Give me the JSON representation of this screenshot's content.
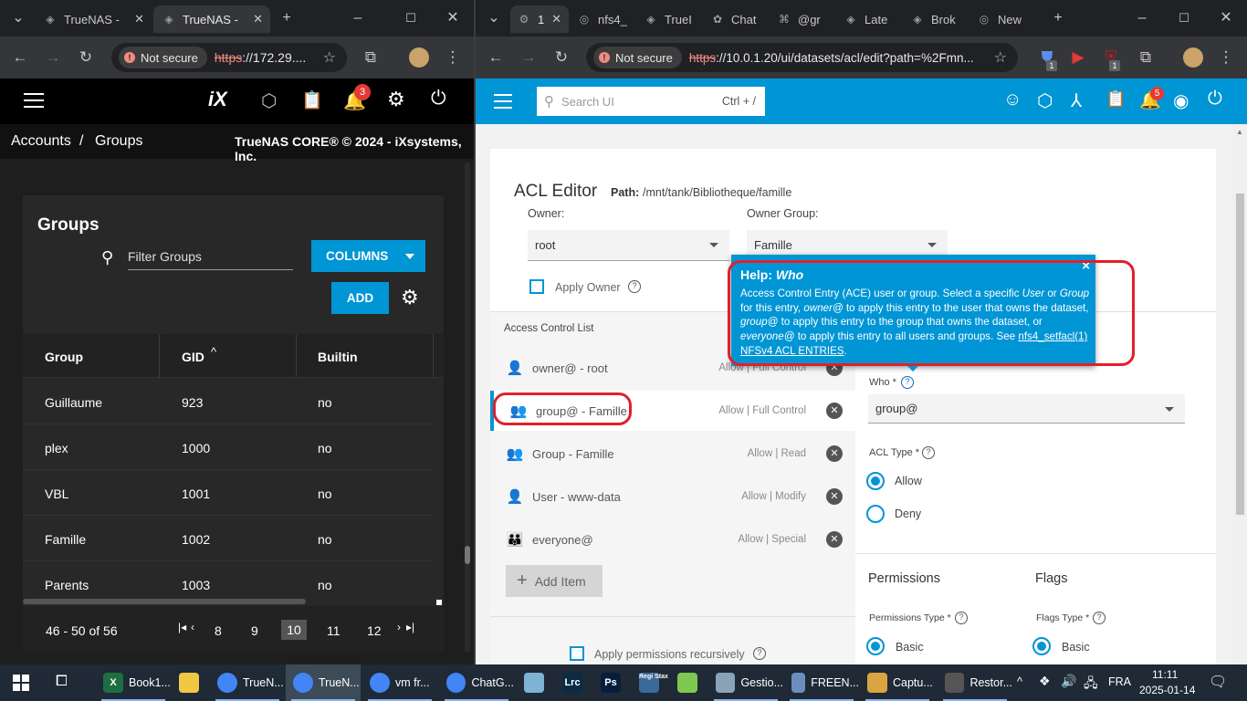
{
  "left_browser": {
    "tabs": [
      {
        "label": "TrueNAS -",
        "active": false
      },
      {
        "label": "TrueNAS -",
        "active": true
      }
    ],
    "not_secure": "Not secure",
    "url_scheme": "https",
    "url_rest": "://172.29....",
    "header": {
      "notif_count": "3"
    },
    "breadcrumb": {
      "accounts": "Accounts",
      "sep": "/",
      "groups": "Groups",
      "copyright": "TrueNAS CORE® © 2024 - iXsystems, Inc."
    },
    "groups": {
      "title": "Groups",
      "filter_placeholder": "Filter Groups",
      "columns_label": "COLUMNS",
      "add_label": "ADD",
      "headers": [
        "Group",
        "GID",
        "Builtin"
      ],
      "sort_indicator": "^",
      "rows": [
        {
          "group": "Guillaume",
          "gid": "923",
          "builtin": "no"
        },
        {
          "group": "plex",
          "gid": "1000",
          "builtin": "no"
        },
        {
          "group": "VBL",
          "gid": "1001",
          "builtin": "no"
        },
        {
          "group": "Famille",
          "gid": "1002",
          "builtin": "no"
        },
        {
          "group": "Parents",
          "gid": "1003",
          "builtin": "no"
        }
      ],
      "range": "46 - 50 of 56",
      "pages": [
        "8",
        "9",
        "10",
        "11",
        "12"
      ],
      "current_page": "10"
    }
  },
  "right_browser": {
    "tabs": [
      "1",
      "nfs4_",
      "TrueI",
      "Chat",
      "@gr",
      "Late",
      "Brok",
      "New"
    ],
    "not_secure": "Not secure",
    "url_scheme": "https",
    "url_rest": "://10.0.1.20/ui/datasets/acl/edit?path=%2Fmn...",
    "ext_badges": [
      "1",
      "1"
    ],
    "search_placeholder": "Search UI",
    "search_shortcut": "Ctrl + /",
    "notif_count": "5",
    "acl": {
      "title": "ACL Editor",
      "path_label": "Path:",
      "path_value": "/mnt/tank/Bibliotheque/famille",
      "owner_label": "Owner:",
      "owner_value": "root",
      "owner_group_label": "Owner Group:",
      "owner_group_value": "Famille",
      "apply_owner": "Apply Owner",
      "list_title": "Access Control List",
      "entries": [
        {
          "name": "owner@ - root",
          "perm": "Allow | Full Control",
          "icon": "person-icon"
        },
        {
          "name": "group@ - Famille",
          "perm": "Allow | Full Control",
          "icon": "group-icon"
        },
        {
          "name": "Group - Famille",
          "perm": "Allow | Read",
          "icon": "group-icon"
        },
        {
          "name": "User - www-data",
          "perm": "Allow | Modify",
          "icon": "person-icon"
        },
        {
          "name": "everyone@",
          "perm": "Allow | Special",
          "icon": "groups-icon"
        }
      ],
      "add_item": "Add Item",
      "apply_recursive": "Apply permissions recursively",
      "who_label": "Who *",
      "who_value": "group@",
      "acl_type_label": "ACL Type *",
      "allow": "Allow",
      "deny": "Deny",
      "permissions_title": "Permissions",
      "flags_title": "Flags",
      "permissions_type_label": "Permissions Type *",
      "flags_type_label": "Flags Type *",
      "basic": "Basic",
      "help": {
        "title_prefix": "Help: ",
        "title_word": "Who",
        "close": "×",
        "t1": "Access Control Entry (ACE) user or group. Select a specific ",
        "i1": "User",
        "t2": " or ",
        "i2": "Group",
        "t3": " for this entry, ",
        "i3": "owner@",
        "t4": " to apply this entry to the user that owns the dataset, ",
        "i4": "group@",
        "t5": " to apply this entry to the group that owns the dataset, or ",
        "i5": "everyone@",
        "t6": " to apply this entry to all users and groups. See ",
        "link": "nfs4_setfacl(1) NFSv4 ACL ENTRIES",
        "t7": "."
      }
    }
  },
  "taskbar": {
    "items": [
      {
        "label": "Book1...",
        "icon_text": "X",
        "color": "#1d6f42"
      },
      {
        "label": "",
        "icon_text": "",
        "color": "#f2c744"
      },
      {
        "label": "TrueN...",
        "icon_text": "",
        "color": "#4285f4"
      },
      {
        "label": "TrueN...",
        "icon_text": "",
        "color": "#4285f4"
      },
      {
        "label": "vm fr...",
        "icon_text": "",
        "color": "#4285f4"
      },
      {
        "label": "ChatG...",
        "icon_text": "",
        "color": "#4285f4"
      },
      {
        "label": "",
        "icon_text": "",
        "color": "#7fb3d5"
      },
      {
        "label": "",
        "icon_text": "Lrc",
        "color": "#0b2b44"
      },
      {
        "label": "",
        "icon_text": "Ps",
        "color": "#061e3c"
      },
      {
        "label": "",
        "icon_text": "Regi Stax",
        "color": "#3a6a9a"
      },
      {
        "label": "",
        "icon_text": "",
        "color": "#7ec850"
      },
      {
        "label": "Gestio...",
        "icon_text": "",
        "color": "#8aa3b8"
      },
      {
        "label": "FREEN...",
        "icon_text": "",
        "color": "#6c8ebf"
      },
      {
        "label": "Captu...",
        "icon_text": "",
        "color": "#d9a441"
      },
      {
        "label": "Restor...",
        "icon_text": "",
        "color": "#555555"
      }
    ],
    "lang": "FRA",
    "time": "11:11",
    "date": "2025-01-14"
  },
  "colors": {
    "truenas_blue": "#0095d5",
    "annotation_red": "#e0202a"
  }
}
